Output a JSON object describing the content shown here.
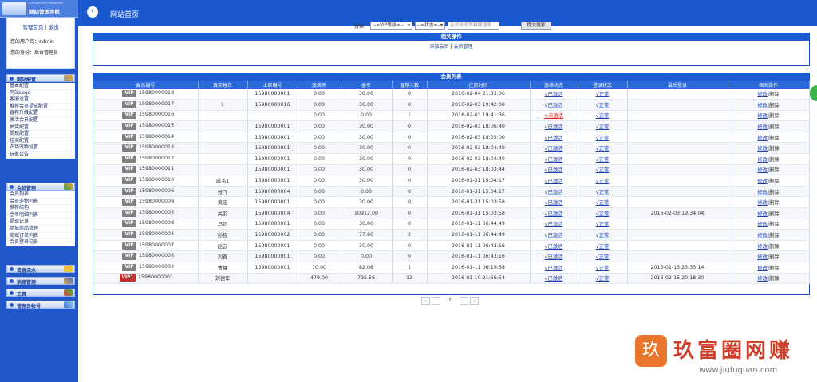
{
  "sidebar": {
    "title": "网站管理导航",
    "subtitle": "management navigation",
    "home_link": "管理首页",
    "sep": "|",
    "logout": "退出",
    "user_line": "您的用户名：admin",
    "role_line": "您的身份：后台管理员",
    "sections": [
      {
        "label": "网站配置",
        "items": [
          "基本配置",
          "网站Logo",
          "客服设置",
          "推荐会员提成配置",
          "直荐升级配置",
          "激活会员配置",
          "抽奖配置",
          "提现配置",
          "挂买配置",
          "农场宠物设置",
          "玩家公告"
        ]
      },
      {
        "label": "会员管理",
        "items": [
          "会员列表",
          "会员宠物列表",
          "推荐结构",
          "金币明细列表",
          "提现记录",
          "商城商品管理",
          "商城订单列表",
          "会员登录记录"
        ]
      },
      {
        "label": "资金流水",
        "items": []
      },
      {
        "label": "消息管理",
        "items": []
      },
      {
        "label": "工具",
        "items": []
      },
      {
        "label": "管理员帐号",
        "items": []
      }
    ]
  },
  "topbar": {
    "back_icon": "‹",
    "breadcrumb": "网站首页"
  },
  "ops": {
    "title": "相关操作",
    "add_member": "添加会员",
    "sep": "|",
    "member_manage": "会员管理",
    "search_label": "搜索：",
    "vip_select": "--=VIP等级=--",
    "status_select": "--=状态=--",
    "search_placeholder": "会员帐号等模糊搜索",
    "search_button": "提交搜索"
  },
  "list": {
    "title": "会员列表",
    "headers": [
      "会员编号",
      "真实姓名",
      "上家编号",
      "激活币",
      "金币",
      "直荐人数",
      "注册时间",
      "激活状态",
      "登录状态",
      "最后登录",
      "相关操作"
    ],
    "edit": "修改",
    "delete": "删除",
    "rows": [
      {
        "vip": "VIP",
        "id": "15980000018",
        "name": "",
        "parent": "15980000001",
        "act": "0.00",
        "gold": "30.00",
        "refs": "0",
        "reg": "2016-02-04 21:33:06",
        "astate": "√已激活",
        "lstate": "√正常",
        "last": ""
      },
      {
        "vip": "VIP",
        "id": "15980000017",
        "name": "1",
        "parent": "15980000016",
        "act": "0.00",
        "gold": "30.00",
        "refs": "0",
        "reg": "2016-02-03 19:42:00",
        "astate": "√已激活",
        "lstate": "√正常",
        "last": ""
      },
      {
        "vip": "VIP",
        "id": "15980000016",
        "name": "",
        "parent": "",
        "act": "0.00",
        "gold": "0.00",
        "refs": "1",
        "reg": "2016-02-03 19:41:36",
        "astate": "×未激活",
        "lstate": "√正常",
        "last": ""
      },
      {
        "vip": "VIP",
        "id": "15980000015",
        "name": "",
        "parent": "15980000001",
        "act": "0.00",
        "gold": "30.00",
        "refs": "0",
        "reg": "2016-02-03 18:06:40",
        "astate": "√已激活",
        "lstate": "√正常",
        "last": ""
      },
      {
        "vip": "VIP",
        "id": "15980000014",
        "name": "",
        "parent": "15980000001",
        "act": "0.00",
        "gold": "30.00",
        "refs": "0",
        "reg": "2016-02-03 18:05:00",
        "astate": "√已激活",
        "lstate": "√正常",
        "last": ""
      },
      {
        "vip": "VIP",
        "id": "15980000013",
        "name": "",
        "parent": "15980000001",
        "act": "0.00",
        "gold": "30.00",
        "refs": "0",
        "reg": "2016-02-03 18:04:49",
        "astate": "√已激活",
        "lstate": "√正常",
        "last": ""
      },
      {
        "vip": "VIP",
        "id": "15980000012",
        "name": "",
        "parent": "15980000001",
        "act": "0.00",
        "gold": "30.00",
        "refs": "0",
        "reg": "2016-02-03 18:04:40",
        "astate": "√已激活",
        "lstate": "√正常",
        "last": ""
      },
      {
        "vip": "VIP",
        "id": "15980000011",
        "name": "",
        "parent": "15980000001",
        "act": "0.00",
        "gold": "30.00",
        "refs": "0",
        "reg": "2016-02-03 18:03:44",
        "astate": "√已激活",
        "lstate": "√正常",
        "last": ""
      },
      {
        "vip": "VIP",
        "id": "15980000010",
        "name": "典韦1",
        "parent": "15980000001",
        "act": "0.00",
        "gold": "30.00",
        "refs": "0",
        "reg": "2016-01-31 15:04:17",
        "astate": "√已激活",
        "lstate": "√正常",
        "last": ""
      },
      {
        "vip": "VIP",
        "id": "15980000006",
        "name": "张飞",
        "parent": "15980000004",
        "act": "0.00",
        "gold": "0.00",
        "refs": "0",
        "reg": "2016-01-31 15:04:17",
        "astate": "√已激活",
        "lstate": "√正常",
        "last": ""
      },
      {
        "vip": "VIP",
        "id": "15980000009",
        "name": "黄忠",
        "parent": "15980000001",
        "act": "0.00",
        "gold": "30.00",
        "refs": "0",
        "reg": "2016-01-31 15:03:58",
        "astate": "√已激活",
        "lstate": "√正常",
        "last": ""
      },
      {
        "vip": "VIP",
        "id": "15980000005",
        "name": "关羽",
        "parent": "15980000004",
        "act": "0.00",
        "gold": "10912.00",
        "refs": "0",
        "reg": "2016-01-31 15:03:58",
        "astate": "√已激活",
        "lstate": "√正常",
        "last": "2016-02-03 19:34:04"
      },
      {
        "vip": "VIP",
        "id": "15980000008",
        "name": "马超",
        "parent": "15980000001",
        "act": "0.00",
        "gold": "30.00",
        "refs": "0",
        "reg": "2016-01-11 06:44:49",
        "astate": "√已激活",
        "lstate": "√正常",
        "last": ""
      },
      {
        "vip": "VIP",
        "id": "15980000004",
        "name": "孙权",
        "parent": "15980000002",
        "act": "0.00",
        "gold": "77.60",
        "refs": "2",
        "reg": "2016-01-11 06:44:49",
        "astate": "√已激活",
        "lstate": "√正常",
        "last": ""
      },
      {
        "vip": "VIP",
        "id": "15980000007",
        "name": "赵云",
        "parent": "15980000001",
        "act": "0.00",
        "gold": "30.00",
        "refs": "0",
        "reg": "2016-01-11 06:43:16",
        "astate": "√已激活",
        "lstate": "√正常",
        "last": ""
      },
      {
        "vip": "VIP",
        "id": "15980000003",
        "name": "刘备",
        "parent": "15980000001",
        "act": "0.00",
        "gold": "0.00",
        "refs": "0",
        "reg": "2016-01-11 06:43:16",
        "astate": "√已激活",
        "lstate": "√正常",
        "last": ""
      },
      {
        "vip": "VIP",
        "id": "15980000002",
        "name": "曹操",
        "parent": "15980000001",
        "act": "70.00",
        "gold": "82.08",
        "refs": "1",
        "reg": "2016-01-11 06:19:58",
        "astate": "√已激活",
        "lstate": "√正常",
        "last": "2016-02-15 23:33:14"
      },
      {
        "vip": "VIP1",
        "id": "15980000001",
        "name": "刘德华",
        "parent": "",
        "act": "479.00",
        "gold": "795.56",
        "refs": "12",
        "reg": "2016-01-10 21:56:54",
        "astate": "√已激活",
        "lstate": "√正常",
        "last": "2016-02-15 20:18:30"
      }
    ]
  },
  "pager": {
    "first": "«",
    "prev": "‹",
    "page": "1",
    "next": "›",
    "last": "»"
  },
  "watermark": {
    "glyph": "玖",
    "brand": "玖富圈网赚",
    "url": "www.jiufuquan.com"
  },
  "colors": {
    "primary": "#1b5bd3",
    "sidebar": "#2257c9",
    "inactive": "#e0241f"
  }
}
